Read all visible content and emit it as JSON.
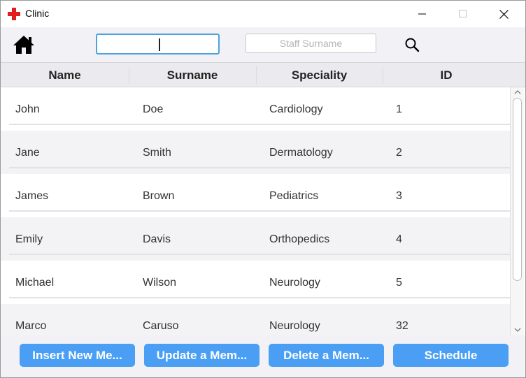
{
  "window": {
    "title": "Clinic"
  },
  "toolbar": {
    "search_value": "",
    "surname_placeholder": "Staff Surname"
  },
  "table": {
    "columns": [
      "Name",
      "Surname",
      "Speciality",
      "ID"
    ],
    "rows": [
      [
        "John",
        "Doe",
        "Cardiology",
        "1"
      ],
      [
        "Jane",
        "Smith",
        "Dermatology",
        "2"
      ],
      [
        "James",
        "Brown",
        "Pediatrics",
        "3"
      ],
      [
        "Emily",
        "Davis",
        "Orthopedics",
        "4"
      ],
      [
        "Michael",
        "Wilson",
        "Neurology",
        "5"
      ],
      [
        "Marco",
        "Caruso",
        "Neurology",
        "32"
      ]
    ]
  },
  "buttons": {
    "insert": "Insert New Me...",
    "update": "Update a Mem...",
    "delete": "Delete a Mem...",
    "schedule": "Schedule"
  },
  "colors": {
    "accent": "#4a9ff5",
    "focus_border": "#4aa3df",
    "app_icon": "#e02020"
  }
}
